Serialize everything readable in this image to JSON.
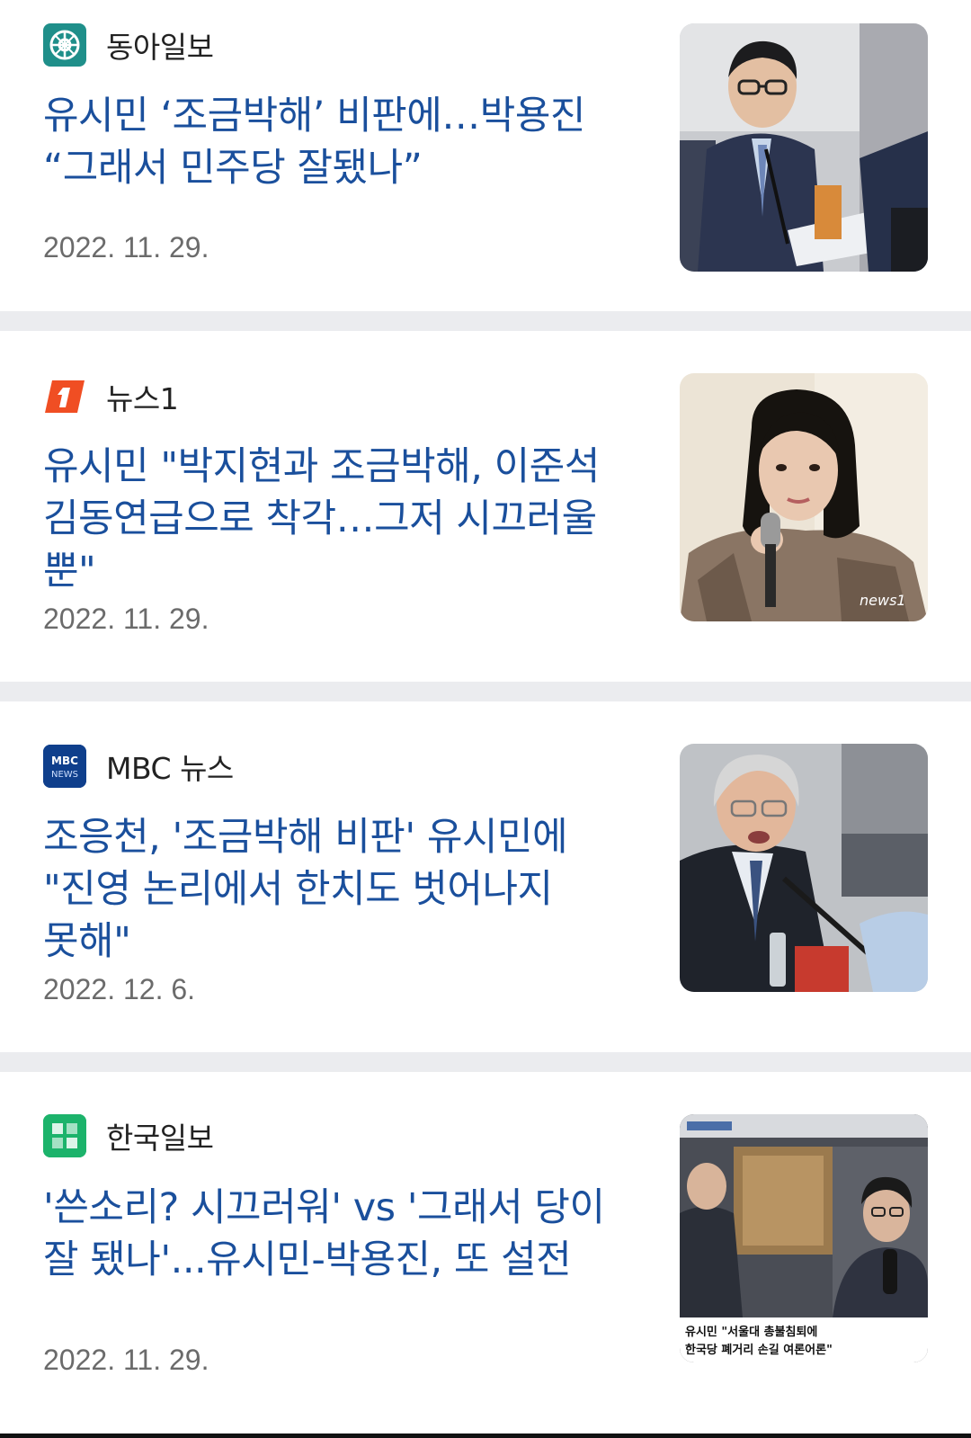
{
  "articles": [
    {
      "source": "동아일보",
      "logo_icon": "donga-logo-icon",
      "logo_color": "#1f8f8a",
      "headline": "유시민 ‘조금박해’ 비판에…박용진 “그래서 민주당 잘됐나”",
      "date": "2022. 11. 29.",
      "thumbnail": "man-in-suit-at-microphone-photo"
    },
    {
      "source": "뉴스1",
      "logo_icon": "news1-logo-icon",
      "logo_color": "#f04e23",
      "headline": "유시민 \"박지현과 조금박해, 이준석 김동연급으로 착각…그저 시끄러울 뿐\"",
      "date": "2022. 11. 29.",
      "thumbnail": "woman-holding-microphone-photo"
    },
    {
      "source": "MBC 뉴스",
      "logo_icon": "mbc-news-logo-icon",
      "logo_color": "#0f3f8c",
      "headline": "조응천, '조금박해 비판' 유시민에 \"진영 논리에서 한치도 벗어나지 못해\"",
      "date": "2022. 12. 6.",
      "thumbnail": "grey-haired-man-speaking-photo"
    },
    {
      "source": "한국일보",
      "logo_icon": "hankook-logo-icon",
      "logo_color": "#1cb36b",
      "headline": "'쓴소리? 시끄러워' vs '그래서 당이 잘 됐나'...유시민-박용진, 또 설전",
      "date": "2022. 11. 29.",
      "thumbnail": "tv-broadcast-still-photo",
      "thumbnail_caption_line1": "유시민 \"서울대 총불침퇴에",
      "thumbnail_caption_line2": "한국당 폐거리 손길 여론어론\""
    }
  ],
  "colors": {
    "headline": "#1a4f9c",
    "date": "#6b6b6b",
    "separator": "#ebecef"
  }
}
